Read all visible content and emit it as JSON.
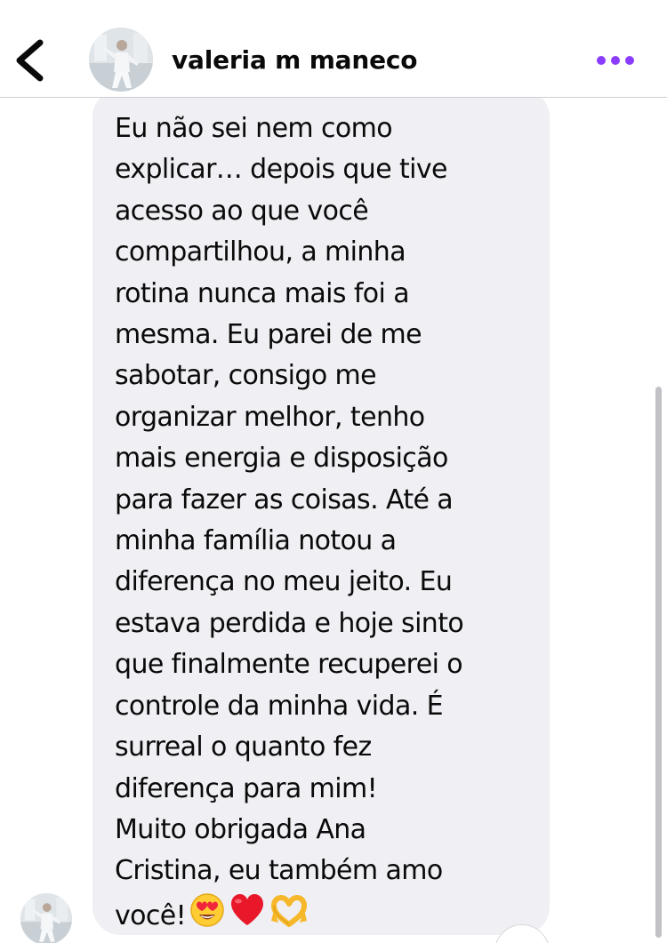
{
  "header": {
    "back_icon": "chevron-left-icon",
    "contact_name": "valeria m maneco",
    "more_icon": "more-horizontal-icon",
    "accent_color": "#8b3dff"
  },
  "message": {
    "text": "Eu não sei nem como\nexplicar… depois que tive\nacesso ao que você\ncompartilhou, a minha\nrotina nunca mais foi a\nmesma. Eu parei de me\nsabotar, consigo me\norganizar melhor, tenho\nmais energia e disposição\npara fazer as coisas. Até a\nminha família notou a\ndiferença no meu jeito. Eu\nestava perdida e hoje sinto\nque finalmente recuperei o\ncontrole da minha vida. É\nsurreal o quanto fez\ndiferença para mim!\nMuito obrigada Ana\nCristina, eu também amo\nvocê!",
    "emojis": [
      "heart-eyes-emoji",
      "red-heart-emoji",
      "heart-hands-emoji"
    ],
    "bubble_color": "#efeff4"
  }
}
